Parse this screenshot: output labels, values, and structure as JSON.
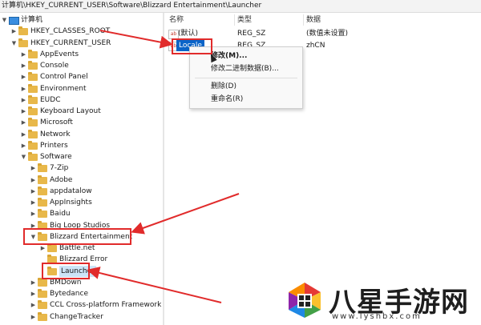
{
  "address_bar": "计算机\\HKEY_CURRENT_USER\\Software\\Blizzard Entertainment\\Launcher",
  "tree": [
    {
      "label": "计算机",
      "depth": 0,
      "icon": "computer-icon",
      "expanded": true
    },
    {
      "label": "HKEY_CLASSES_ROOT",
      "depth": 1,
      "icon": "folder-icon",
      "expanded": false
    },
    {
      "label": "HKEY_CURRENT_USER",
      "depth": 1,
      "icon": "folder-icon",
      "expanded": true
    },
    {
      "label": "AppEvents",
      "depth": 2,
      "icon": "folder-icon",
      "expanded": false
    },
    {
      "label": "Console",
      "depth": 2,
      "icon": "folder-icon",
      "expanded": false
    },
    {
      "label": "Control Panel",
      "depth": 2,
      "icon": "folder-icon",
      "expanded": false
    },
    {
      "label": "Environment",
      "depth": 2,
      "icon": "folder-icon",
      "expanded": false
    },
    {
      "label": "EUDC",
      "depth": 2,
      "icon": "folder-icon",
      "expanded": false
    },
    {
      "label": "Keyboard Layout",
      "depth": 2,
      "icon": "folder-icon",
      "expanded": false
    },
    {
      "label": "Microsoft",
      "depth": 2,
      "icon": "folder-icon",
      "expanded": false
    },
    {
      "label": "Network",
      "depth": 2,
      "icon": "folder-icon",
      "expanded": false
    },
    {
      "label": "Printers",
      "depth": 2,
      "icon": "folder-icon",
      "expanded": false
    },
    {
      "label": "Software",
      "depth": 2,
      "icon": "folder-icon",
      "expanded": true
    },
    {
      "label": "7-Zip",
      "depth": 3,
      "icon": "folder-icon",
      "expanded": false
    },
    {
      "label": "Adobe",
      "depth": 3,
      "icon": "folder-icon",
      "expanded": false
    },
    {
      "label": "appdatalow",
      "depth": 3,
      "icon": "folder-icon",
      "expanded": false
    },
    {
      "label": "AppInsights",
      "depth": 3,
      "icon": "folder-icon",
      "expanded": false
    },
    {
      "label": "Baidu",
      "depth": 3,
      "icon": "folder-icon",
      "expanded": false
    },
    {
      "label": "Big Loop Studios",
      "depth": 3,
      "icon": "folder-icon",
      "expanded": false
    },
    {
      "label": "Blizzard Entertainment",
      "depth": 3,
      "icon": "folder-icon",
      "expanded": true
    },
    {
      "label": "Battle.net",
      "depth": 4,
      "icon": "folder-icon",
      "expanded": false
    },
    {
      "label": "Blizzard Error",
      "depth": 4,
      "icon": "folder-icon",
      "leaf": true
    },
    {
      "label": "Launcher",
      "depth": 4,
      "icon": "folder-icon",
      "leaf": true,
      "selected": true
    },
    {
      "label": "BMDown",
      "depth": 3,
      "icon": "folder-icon",
      "expanded": false
    },
    {
      "label": "Bytedance",
      "depth": 3,
      "icon": "folder-icon",
      "expanded": false
    },
    {
      "label": "CCL Cross-platform Framework",
      "depth": 3,
      "icon": "folder-icon",
      "expanded": false
    },
    {
      "label": "ChangeTracker",
      "depth": 3,
      "icon": "folder-icon",
      "expanded": false
    }
  ],
  "columns": {
    "name": "名称",
    "type": "类型",
    "data": "数据"
  },
  "values": [
    {
      "name": "(默认)",
      "type": "REG_SZ",
      "data": "(数值未设置)",
      "icon": "string-value-icon"
    },
    {
      "name": "Locale",
      "type": "REG_SZ",
      "data": "zhCN",
      "icon": "string-value-icon",
      "selected": true
    }
  ],
  "context_menu": {
    "items": [
      "修改(M)...",
      "修改二进制数据(B)...",
      "删除(D)",
      "重命名(R)"
    ]
  },
  "watermark": {
    "text": "八星手游网",
    "url": "www.lyshbx.com"
  },
  "colors": {
    "highlight": "#e12b2b",
    "selection": "#0a64c8",
    "folder": "#e8b84a"
  }
}
